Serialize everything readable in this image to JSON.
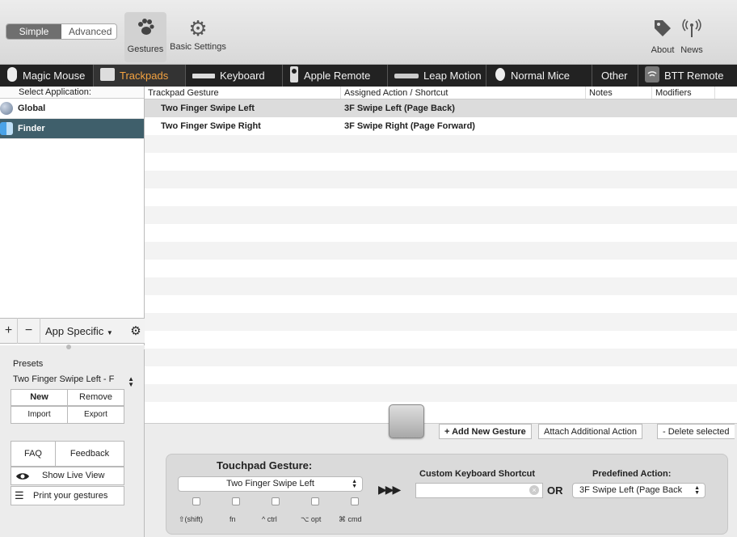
{
  "toolbar": {
    "mode_simple": "Simple",
    "mode_advanced": "Advanced",
    "gestures_label": "Gestures",
    "basic_settings_label": "Basic Settings",
    "about_label": "About",
    "news_label": "News"
  },
  "tabs": [
    {
      "label": "Magic Mouse",
      "icon": "mouse-icon"
    },
    {
      "label": "Trackpads",
      "icon": "trackpad-icon"
    },
    {
      "label": "Keyboard",
      "icon": "keyboard-icon"
    },
    {
      "label": "Apple Remote",
      "icon": "remote-icon"
    },
    {
      "label": "Leap Motion",
      "icon": "leap-icon"
    },
    {
      "label": "Normal Mice",
      "icon": "mouse-icon"
    },
    {
      "label": "Other",
      "icon": ""
    },
    {
      "label": "BTT Remote",
      "icon": "wifi-icon"
    }
  ],
  "active_tab": "Trackpads",
  "apps": {
    "header": "Select Application:",
    "items": [
      {
        "label": "Global",
        "selected": false
      },
      {
        "label": "Finder",
        "selected": true
      }
    ],
    "scope_label": "App Specific"
  },
  "presets": {
    "title": "Presets",
    "current": "Two Finger Swipe Left - F",
    "new_label": "New",
    "remove_label": "Remove",
    "import_label": "Import",
    "export_label": "Export",
    "faq_label": "FAQ",
    "feedback_label": "Feedback",
    "live_view_label": "Show Live View",
    "print_label": "Print your gestures"
  },
  "table": {
    "headers": [
      "Trackpad Gesture",
      "Assigned Action / Shortcut",
      "Notes",
      "Modifiers"
    ],
    "rows": [
      {
        "gesture": "Two Finger Swipe Left",
        "action": "3F Swipe Left (Page Back)"
      },
      {
        "gesture": "Two Finger Swipe Right",
        "action": "3F Swipe Right (Page Forward)"
      }
    ]
  },
  "actions": {
    "add": "+ Add New Gesture",
    "attach": "Attach Additional Action",
    "delete": "- Delete selected"
  },
  "editor": {
    "gesture_title": "Touchpad Gesture:",
    "gesture_value": "Two Finger Swipe Left",
    "shortcut_title": "Custom Keyboard Shortcut",
    "or_label": "OR",
    "predefined_title": "Predefined Action:",
    "predefined_value": "3F Swipe Left (Page Back",
    "arrows": "▶▶▶",
    "modifiers": [
      "⇧(shift)",
      "fn",
      "^ ctrl",
      "⌥ opt",
      "⌘ cmd"
    ]
  }
}
